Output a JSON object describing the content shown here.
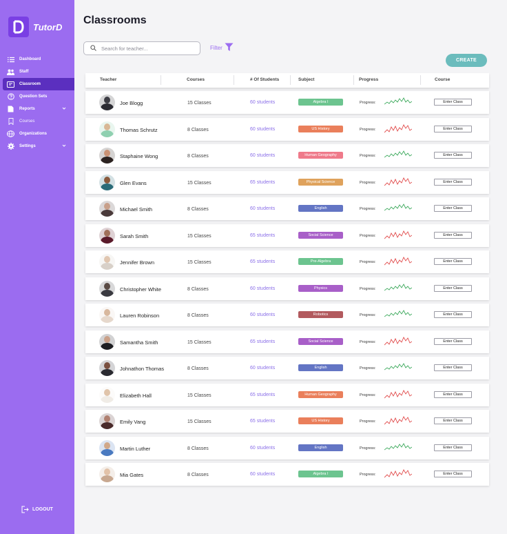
{
  "app": {
    "logo_text": "TutorD"
  },
  "sidebar": {
    "items": [
      {
        "label": "Dashboard",
        "icon": "list-icon",
        "active": false,
        "sub": false,
        "caret": false
      },
      {
        "label": "Staff",
        "icon": "users-icon",
        "active": false,
        "sub": false,
        "caret": false
      },
      {
        "label": "Classroom",
        "icon": "classroom-icon",
        "active": true,
        "sub": false,
        "caret": false
      },
      {
        "label": "Question Sets",
        "icon": "question-icon",
        "active": false,
        "sub": false,
        "caret": false
      },
      {
        "label": "Reports",
        "icon": "report-icon",
        "active": false,
        "sub": false,
        "caret": true
      },
      {
        "label": "Courses",
        "icon": "bookmark-icon",
        "active": false,
        "sub": true,
        "caret": false
      },
      {
        "label": "Organizations",
        "icon": "globe-icon",
        "active": false,
        "sub": false,
        "caret": false
      },
      {
        "label": "Settings",
        "icon": "gear-icon",
        "active": false,
        "sub": false,
        "caret": true
      }
    ],
    "logout_label": "LOGOUT"
  },
  "main": {
    "title": "Classrooms",
    "search_placeholder": "Search for teacher...",
    "filter_label": "Filter",
    "create_label": "CREATE",
    "columns": [
      "Teacher",
      "Courses",
      "# Of Students",
      "Subject",
      "Progress",
      "Course"
    ],
    "rows": [
      {
        "teacher": "Joe Blogg",
        "courses": "15 Classes",
        "students": "60 students",
        "subject": "Algebra I",
        "subject_color": "#6cc48f",
        "progress_label": "Progress:",
        "trend": "up",
        "action": "Enter Class",
        "skin": "#3d3d44",
        "shirt": "#2c2c33"
      },
      {
        "teacher": "Thomas Schrutz",
        "courses": "8 Classes",
        "students": "60 students",
        "subject": "US History",
        "subject_color": "#ea7f5b",
        "progress_label": "Progress:",
        "trend": "down",
        "action": "Enter Class",
        "skin": "#d8b896",
        "shirt": "#8fd0b0"
      },
      {
        "teacher": "Staphaine Wong",
        "courses": "8 Classes",
        "students": "60 students",
        "subject": "Human Geography",
        "subject_color": "#ef7a8a",
        "progress_label": "Progress:",
        "trend": "up",
        "action": "Enter Class",
        "skin": "#c99274",
        "shirt": "#2b2220"
      },
      {
        "teacher": "Glen Evans",
        "courses": "15 Classes",
        "students": "65 students",
        "subject": "Physical Science",
        "subject_color": "#dfa25c",
        "progress_label": "Progress:",
        "trend": "down",
        "action": "Enter Class",
        "skin": "#8a5a3c",
        "shirt": "#2a6b78"
      },
      {
        "teacher": "Michael Smith",
        "courses": "8 Classes",
        "students": "60 students",
        "subject": "English",
        "subject_color": "#6375c4",
        "progress_label": "Progress:",
        "trend": "up",
        "action": "Enter Class",
        "skin": "#c8a08a",
        "shirt": "#4a3a3a"
      },
      {
        "teacher": "Sarah Smith",
        "courses": "15 Classes",
        "students": "65 students",
        "subject": "Social Science",
        "subject_color": "#a85fc8",
        "progress_label": "Progress:",
        "trend": "down",
        "action": "Enter Class",
        "skin": "#a0705a",
        "shirt": "#5a1a2a"
      },
      {
        "teacher": "Jennifer Brown",
        "courses": "15 Classes",
        "students": "65 students",
        "subject": "Pre-Algebra",
        "subject_color": "#6cc48f",
        "progress_label": "Progress:",
        "trend": "down",
        "action": "Enter Class",
        "skin": "#e0c6b0",
        "shirt": "#d8d0c8"
      },
      {
        "teacher": "Christopher White",
        "courses": "8 Classes",
        "students": "60 students",
        "subject": "Physics",
        "subject_color": "#a85fc8",
        "progress_label": "Progress:",
        "trend": "up",
        "action": "Enter Class",
        "skin": "#5a4a44",
        "shirt": "#3a3a40"
      },
      {
        "teacher": "Lauren Robinson",
        "courses": "8 Classes",
        "students": "60 students",
        "subject": "Robotics",
        "subject_color": "#b25a5e",
        "progress_label": "Progress:",
        "trend": "up",
        "action": "Enter Class",
        "skin": "#d8b89e",
        "shirt": "#e6d8cc"
      },
      {
        "teacher": "Samantha Smith",
        "courses": "15 Classes",
        "students": "65 students",
        "subject": "Social Science",
        "subject_color": "#a85fc8",
        "progress_label": "Progress:",
        "trend": "down",
        "action": "Enter Class",
        "skin": "#c9a088",
        "shirt": "#1e1e22"
      },
      {
        "teacher": "Johnathon Thomas",
        "courses": "8 Classes",
        "students": "60 students",
        "subject": "English",
        "subject_color": "#6375c4",
        "progress_label": "Progress:",
        "trend": "up",
        "action": "Enter Class",
        "skin": "#7a5040",
        "shirt": "#2a2a30"
      },
      {
        "teacher": "Elizabeth Hall",
        "courses": "15 Classes",
        "students": "65 students",
        "subject": "Human Geography",
        "subject_color": "#ea7f5b",
        "progress_label": "Progress:",
        "trend": "down",
        "action": "Enter Class",
        "skin": "#e0c4aa",
        "shirt": "#f0ece6"
      },
      {
        "teacher": "Emily Vang",
        "courses": "15 Classes",
        "students": "65 students",
        "subject": "US History",
        "subject_color": "#ea7f5b",
        "progress_label": "Progress:",
        "trend": "down",
        "action": "Enter Class",
        "skin": "#b08070",
        "shirt": "#4a2a2a"
      },
      {
        "teacher": "Martin Luther",
        "courses": "8 Classes",
        "students": "60 students",
        "subject": "English",
        "subject_color": "#6375c4",
        "progress_label": "Progress:",
        "trend": "up",
        "action": "Enter Class",
        "skin": "#d0a88a",
        "shirt": "#4a7ac0"
      },
      {
        "teacher": "Mia Gates",
        "courses": "8 Classes",
        "students": "60 students",
        "subject": "Algebra I",
        "subject_color": "#6cc48f",
        "progress_label": "Progress:",
        "trend": "down",
        "action": "Enter Class",
        "skin": "#e2c2a8",
        "shirt": "#c8a890"
      }
    ]
  }
}
